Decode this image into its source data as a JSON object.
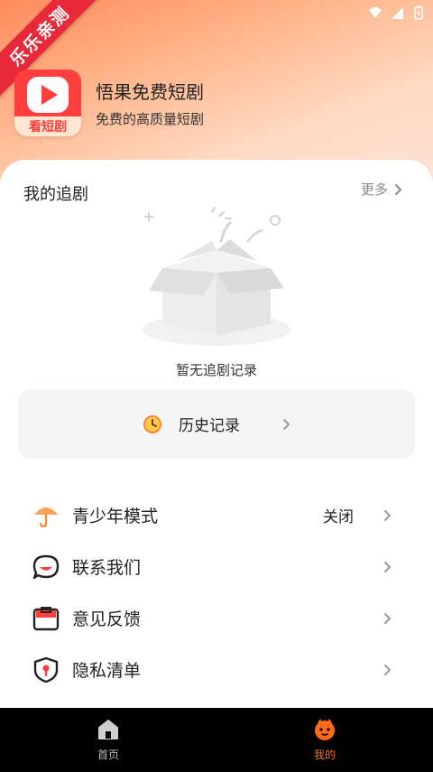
{
  "ribbon": {
    "text": "乐乐亲测"
  },
  "app": {
    "name": "悟果免费短剧",
    "slogan": "免费的高质量短剧",
    "logo_label": "看短剧",
    "brand_color": "#ff3e3e"
  },
  "following": {
    "title": "我的追剧",
    "more_label": "更多",
    "empty_text": "暂无追剧记录"
  },
  "history": {
    "label": "历史记录"
  },
  "menu": [
    {
      "icon": "umbrella-icon",
      "label": "青少年模式",
      "value": "关闭"
    },
    {
      "icon": "chat-bubble-icon",
      "label": "联系我们",
      "value": ""
    },
    {
      "icon": "feedback-box-icon",
      "label": "意见反馈",
      "value": ""
    },
    {
      "icon": "privacy-shield-icon",
      "label": "隐私清单",
      "value": ""
    }
  ],
  "bottom_nav": [
    {
      "icon": "home-icon",
      "label": "首页",
      "active": false
    },
    {
      "icon": "mine-avatar-icon",
      "label": "我的",
      "active": true
    }
  ],
  "colors": {
    "accent": "#ff6a1a",
    "bottom_nav_bg": "#000000"
  }
}
